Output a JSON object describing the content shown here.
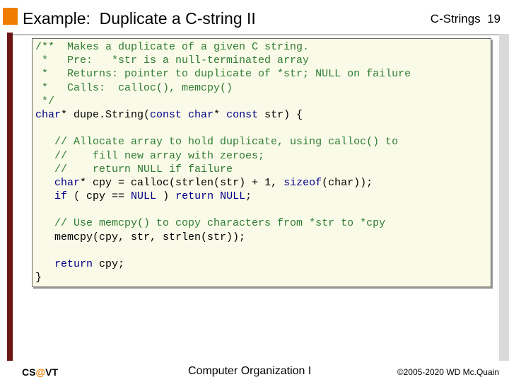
{
  "header": {
    "title": "Example:  Duplicate a C-string II",
    "section": "C-Strings  19"
  },
  "code": {
    "lines": [
      [
        {
          "t": "/**  Makes a duplicate of a given C string.",
          "c": "c-comment"
        }
      ],
      [
        {
          "t": " *   Pre:   *str is a null-terminated array",
          "c": "c-comment"
        }
      ],
      [
        {
          "t": " *   Returns: pointer to duplicate of *str; NULL on failure",
          "c": "c-comment"
        }
      ],
      [
        {
          "t": " *   Calls:  calloc(), memcpy()",
          "c": "c-comment"
        }
      ],
      [
        {
          "t": " */",
          "c": "c-comment"
        }
      ],
      [
        {
          "t": "char",
          "c": "c-kw"
        },
        {
          "t": "* dupe.String(",
          "c": "c-plain"
        },
        {
          "t": "const char",
          "c": "c-kw"
        },
        {
          "t": "* ",
          "c": "c-plain"
        },
        {
          "t": "const",
          "c": "c-kw"
        },
        {
          "t": " str) {",
          "c": "c-plain"
        }
      ],
      [],
      [
        {
          "t": "   // Allocate array to hold duplicate, using calloc() to",
          "c": "c-comment"
        }
      ],
      [
        {
          "t": "   //    fill new array with zeroes;",
          "c": "c-comment"
        }
      ],
      [
        {
          "t": "   //    return NULL if failure",
          "c": "c-comment"
        }
      ],
      [
        {
          "t": "   ",
          "c": "c-plain"
        },
        {
          "t": "char",
          "c": "c-kw"
        },
        {
          "t": "* cpy = calloc(strlen(str) + 1, ",
          "c": "c-plain"
        },
        {
          "t": "sizeof",
          "c": "c-kw"
        },
        {
          "t": "(char));",
          "c": "c-plain"
        }
      ],
      [
        {
          "t": "   ",
          "c": "c-plain"
        },
        {
          "t": "if",
          "c": "c-kw"
        },
        {
          "t": " ( cpy == ",
          "c": "c-plain"
        },
        {
          "t": "NULL",
          "c": "c-kw"
        },
        {
          "t": " ) ",
          "c": "c-plain"
        },
        {
          "t": "return NULL",
          "c": "c-kw"
        },
        {
          "t": ";",
          "c": "c-plain"
        }
      ],
      [],
      [
        {
          "t": "   // Use memcpy() to copy characters from *str to *cpy",
          "c": "c-comment"
        }
      ],
      [
        {
          "t": "   memcpy(cpy, str, strlen(str));",
          "c": "c-plain"
        }
      ],
      [],
      [
        {
          "t": "   ",
          "c": "c-plain"
        },
        {
          "t": "return",
          "c": "c-kw"
        },
        {
          "t": " cpy;",
          "c": "c-plain"
        }
      ],
      [
        {
          "t": "}",
          "c": "c-plain"
        }
      ]
    ]
  },
  "footer": {
    "left_prefix": "CS",
    "left_at": "@",
    "left_suffix": "VT",
    "center": "Computer Organization I",
    "right": "©2005-2020 WD Mc.Quain"
  }
}
